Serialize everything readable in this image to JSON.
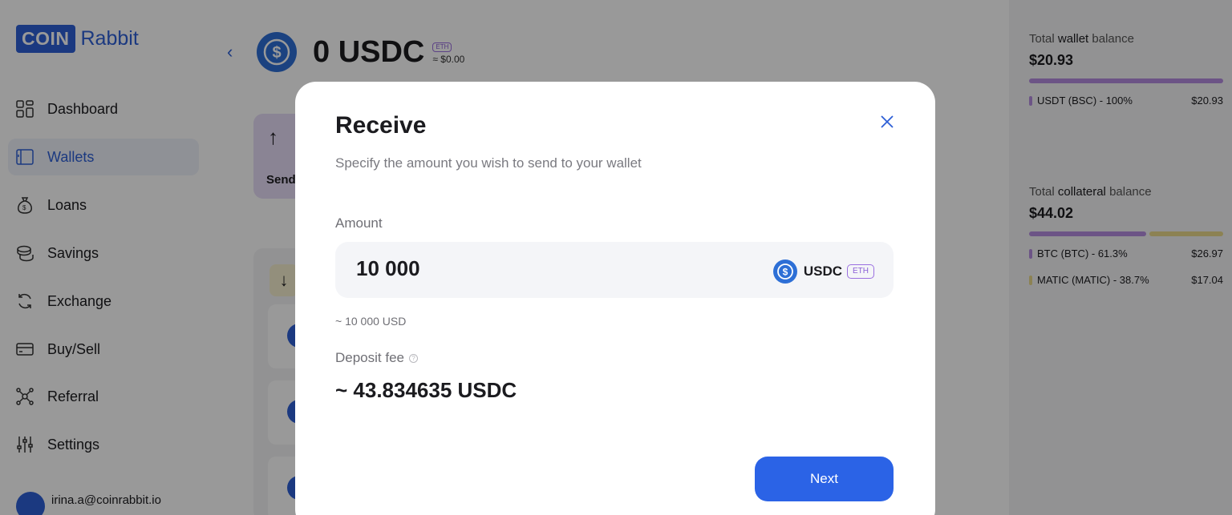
{
  "brand": {
    "logo_box": "COIN",
    "logo_text": "Rabbit"
  },
  "sidebar": {
    "items": [
      {
        "label": "Dashboard",
        "icon": "dashboard-icon"
      },
      {
        "label": "Wallets",
        "icon": "wallet-icon",
        "active": true
      },
      {
        "label": "Loans",
        "icon": "money-bag-icon"
      },
      {
        "label": "Savings",
        "icon": "coins-stack-icon"
      },
      {
        "label": "Exchange",
        "icon": "exchange-icon"
      },
      {
        "label": "Buy/Sell",
        "icon": "card-icon"
      },
      {
        "label": "Referral",
        "icon": "referral-icon"
      },
      {
        "label": "Settings",
        "icon": "sliders-icon"
      }
    ],
    "user_email": "irina.a@coinrabbit.io"
  },
  "wallet": {
    "balance": "0 USDC",
    "network": "ETH",
    "usd_value": "≈ $0.00",
    "send_label": "Send"
  },
  "right_panel": {
    "wallet_balance": {
      "title_pre": "Total",
      "title_bold": "wallet",
      "title_post": "balance",
      "amount": "$20.93",
      "items": [
        {
          "label": "USDT (BSC) - 100%",
          "value": "$20.93",
          "color": "#b58ce0",
          "percent": 100
        }
      ]
    },
    "collateral_balance": {
      "title_pre": "Total",
      "title_bold": "collateral",
      "title_post": "balance",
      "amount": "$44.02",
      "items": [
        {
          "label": "BTC (BTC) - 61.3%",
          "value": "$26.97",
          "color": "#b58ce0",
          "percent": 61.3
        },
        {
          "label": "MATIC (MATIC) - 38.7%",
          "value": "$17.04",
          "color": "#e9d98a",
          "percent": 38.7
        }
      ]
    }
  },
  "modal": {
    "title": "Receive",
    "subtitle": "Specify the amount you wish to send to your wallet",
    "amount_label": "Amount",
    "amount_value": "10 000",
    "currency": "USDC",
    "currency_network": "ETH",
    "approx_usd": "~ 10 000 USD",
    "fee_label": "Deposit fee",
    "fee_value": "~ 43.834635 USDC",
    "next_label": "Next"
  },
  "colors": {
    "accent": "#2b63e6",
    "brand": "#2d5fd6"
  }
}
